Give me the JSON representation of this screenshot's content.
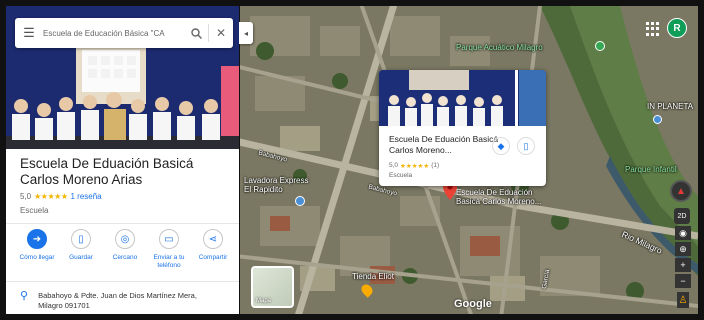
{
  "search": {
    "query": "Escuela de Educación Básica \"CA"
  },
  "place": {
    "name": "Escuela De Eduación Basicá Carlos Moreno Arias",
    "rating": "5,0",
    "stars": "★★★★★",
    "reviews": "1 reseña",
    "category": "Escuela",
    "address": "Babahoyo & Pdte. Juan de Dios Martínez Mera, Milagro 091701"
  },
  "actions": [
    {
      "label": "Cómo llegar",
      "icon": "directions-icon"
    },
    {
      "label": "Guardar",
      "icon": "bookmark-icon"
    },
    {
      "label": "Cercano",
      "icon": "nearby-icon"
    },
    {
      "label": "Enviar a tu teléfono",
      "icon": "phone-icon"
    },
    {
      "label": "Compartir",
      "icon": "share-icon"
    }
  ],
  "card": {
    "title": "Escuela De Eduación Basicá Carlos Moreno...",
    "rating": "5,0",
    "stars": "★★★★★",
    "count": "(1)",
    "category": "Escuela"
  },
  "map": {
    "labels": {
      "parque_acuatico": "Parque Acuático Milagro",
      "in_planeta": "IN PLANETA",
      "parque_infantil": "Parque Infantil",
      "rio_milagro": "Rio Milagro",
      "lavadora": "Lavadora Express El Rapidito",
      "pin_label": "Escuela De Eduación Basicá Carlos Moreno...",
      "tienda": "Tienda Eliot",
      "babahoyo_1": "Babahoyo",
      "babahoyo_2": "Babahoyo",
      "garcia": "García"
    },
    "layers_label": "Mapa",
    "attribution": "Google"
  },
  "controls": {
    "view_2d": "2D",
    "zoom_in": "+",
    "zoom_out": "−"
  },
  "user": {
    "avatar_letter": "R"
  },
  "colors": {
    "accent": "#1a73e8",
    "star": "#f4b400",
    "pin": "#ea4335",
    "avatar": "#0f9d58"
  }
}
